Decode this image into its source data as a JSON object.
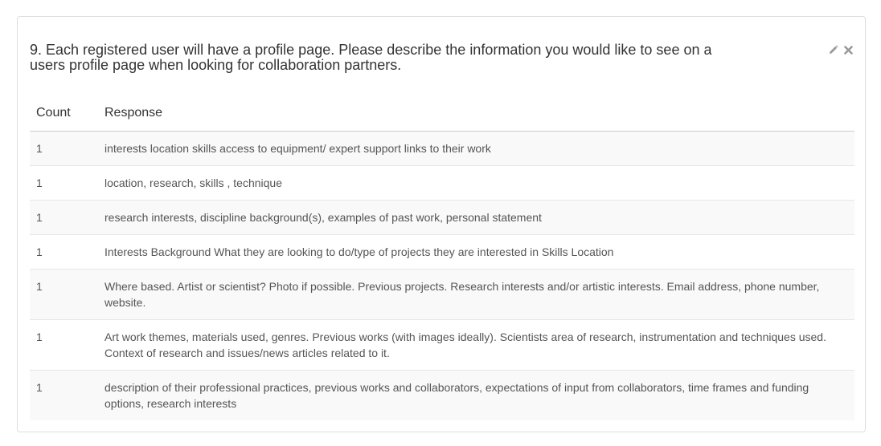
{
  "question": {
    "title": "9. Each registered user will have a profile page. Please describe the information you would like to see on a users profile page when looking for collaboration partners."
  },
  "actions": {
    "edit_icon": "pencil-icon",
    "close_icon": "close-icon",
    "icon_color": "#999999"
  },
  "table": {
    "headers": {
      "count": "Count",
      "response": "Response"
    },
    "rows": [
      {
        "count": "1",
        "response": "interests location skills access to equipment/ expert support links to their work"
      },
      {
        "count": "1",
        "response": "location, research, skills , technique"
      },
      {
        "count": "1",
        "response": "research interests, discipline background(s), examples of past work, personal statement"
      },
      {
        "count": "1",
        "response": "Interests Background What they are looking to do/type of projects they are interested in Skills Location"
      },
      {
        "count": "1",
        "response": "Where based. Artist or scientist? Photo if possible. Previous projects. Research interests and/or artistic interests. Email address, phone number, website."
      },
      {
        "count": "1",
        "response": "Art work themes, materials used, genres. Previous works (with images ideally). Scientists area of research, instrumentation and techniques used. Context of research and issues/news articles related to it."
      },
      {
        "count": "1",
        "response": "description of their professional practices, previous works and collaborators, expectations of input from collaborators, time frames and funding options, research interests"
      }
    ]
  }
}
